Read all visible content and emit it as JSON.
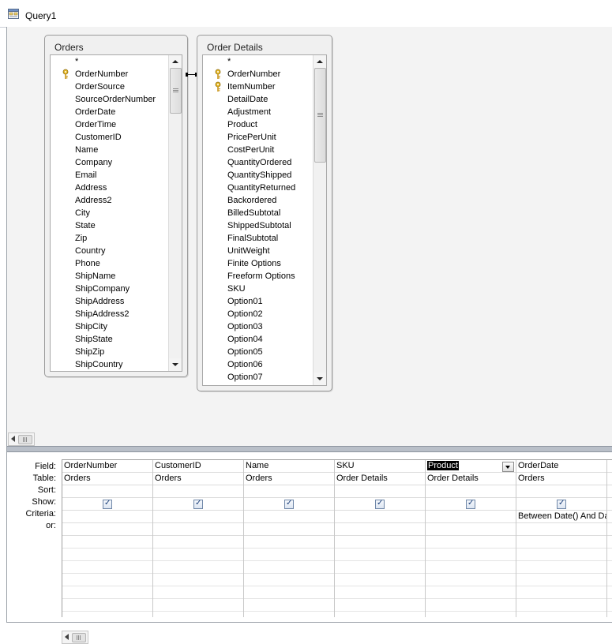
{
  "window": {
    "title": "Query1"
  },
  "tables": [
    {
      "title": "Orders",
      "fields": [
        {
          "name": "*",
          "key": false
        },
        {
          "name": "OrderNumber",
          "key": true
        },
        {
          "name": "OrderSource",
          "key": false
        },
        {
          "name": "SourceOrderNumber",
          "key": false
        },
        {
          "name": "OrderDate",
          "key": false
        },
        {
          "name": "OrderTime",
          "key": false
        },
        {
          "name": "CustomerID",
          "key": false
        },
        {
          "name": "Name",
          "key": false
        },
        {
          "name": "Company",
          "key": false
        },
        {
          "name": "Email",
          "key": false
        },
        {
          "name": "Address",
          "key": false
        },
        {
          "name": "Address2",
          "key": false
        },
        {
          "name": "City",
          "key": false
        },
        {
          "name": "State",
          "key": false
        },
        {
          "name": "Zip",
          "key": false
        },
        {
          "name": "Country",
          "key": false
        },
        {
          "name": "Phone",
          "key": false
        },
        {
          "name": "ShipName",
          "key": false
        },
        {
          "name": "ShipCompany",
          "key": false
        },
        {
          "name": "ShipAddress",
          "key": false
        },
        {
          "name": "ShipAddress2",
          "key": false
        },
        {
          "name": "ShipCity",
          "key": false
        },
        {
          "name": "ShipState",
          "key": false
        },
        {
          "name": "ShipZip",
          "key": false
        },
        {
          "name": "ShipCountry",
          "key": false
        }
      ]
    },
    {
      "title": "Order Details",
      "fields": [
        {
          "name": "*",
          "key": false
        },
        {
          "name": "OrderNumber",
          "key": true
        },
        {
          "name": "ItemNumber",
          "key": true
        },
        {
          "name": "DetailDate",
          "key": false
        },
        {
          "name": "Adjustment",
          "key": false
        },
        {
          "name": "Product",
          "key": false
        },
        {
          "name": "PricePerUnit",
          "key": false
        },
        {
          "name": "CostPerUnit",
          "key": false
        },
        {
          "name": "QuantityOrdered",
          "key": false
        },
        {
          "name": "QuantityShipped",
          "key": false
        },
        {
          "name": "QuantityReturned",
          "key": false
        },
        {
          "name": "Backordered",
          "key": false
        },
        {
          "name": "BilledSubtotal",
          "key": false
        },
        {
          "name": "ShippedSubtotal",
          "key": false
        },
        {
          "name": "FinalSubtotal",
          "key": false
        },
        {
          "name": "UnitWeight",
          "key": false
        },
        {
          "name": "Finite Options",
          "key": false
        },
        {
          "name": "Freeform Options",
          "key": false
        },
        {
          "name": "SKU",
          "key": false
        },
        {
          "name": "Option01",
          "key": false
        },
        {
          "name": "Option02",
          "key": false
        },
        {
          "name": "Option03",
          "key": false
        },
        {
          "name": "Option04",
          "key": false
        },
        {
          "name": "Option05",
          "key": false
        },
        {
          "name": "Option06",
          "key": false
        },
        {
          "name": "Option07",
          "key": false
        }
      ]
    }
  ],
  "grid": {
    "row_labels": [
      "Field:",
      "Table:",
      "Sort:",
      "Show:",
      "Criteria:",
      "or:"
    ],
    "columns": [
      {
        "field": "OrderNumber",
        "table": "Orders",
        "sort": "",
        "show": true,
        "criteria": "",
        "or": "",
        "selected": false
      },
      {
        "field": "CustomerID",
        "table": "Orders",
        "sort": "",
        "show": true,
        "criteria": "",
        "or": "",
        "selected": false
      },
      {
        "field": "Name",
        "table": "Orders",
        "sort": "",
        "show": true,
        "criteria": "",
        "or": "",
        "selected": false
      },
      {
        "field": "SKU",
        "table": "Order Details",
        "sort": "",
        "show": true,
        "criteria": "",
        "or": "",
        "selected": false
      },
      {
        "field": "Product",
        "table": "Order Details",
        "sort": "",
        "show": true,
        "criteria": "",
        "or": "",
        "selected": true
      },
      {
        "field": "OrderDate",
        "table": "Orders",
        "sort": "",
        "show": true,
        "criteria": "Between Date() And Da",
        "or": "",
        "selected": false
      },
      {
        "field": "",
        "table": "",
        "sort": "",
        "show": false,
        "criteria": "",
        "or": "",
        "selected": false
      }
    ]
  },
  "icons": {
    "query": "query-design-icon",
    "key": "primary-key-icon",
    "checkbox": "checkbox-checked-icon"
  },
  "colors": {
    "key_gold": "#d4a017",
    "splitter": "#b9bfc8",
    "selection": "#000000"
  }
}
